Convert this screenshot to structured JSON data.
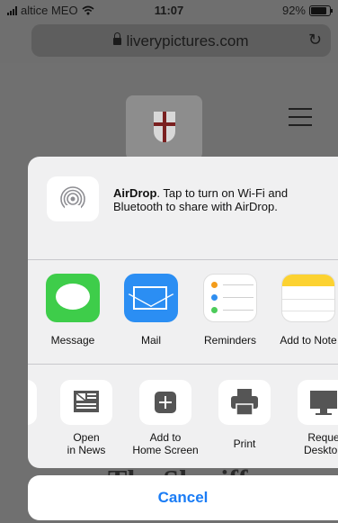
{
  "status_bar": {
    "carrier": "altice MEO",
    "time": "11:07",
    "battery": "92%",
    "battery_level": 0.92
  },
  "url_bar": {
    "domain": "liverypictures.com",
    "reload_icon": "reload-icon"
  },
  "background_page": {
    "heading_partial": "The Sheriff"
  },
  "share_sheet": {
    "airdrop": {
      "title": "AirDrop",
      "description": ". Tap to turn on Wi-Fi and Bluetooth to share with AirDrop."
    },
    "apps": [
      {
        "label": "Message",
        "icon": "message-icon"
      },
      {
        "label": "Mail",
        "icon": "mail-icon"
      },
      {
        "label": "Reminders",
        "icon": "reminders-icon"
      },
      {
        "label": "Add to Note",
        "icon": "notes-icon"
      }
    ],
    "actions": [
      {
        "label_line1": "Open",
        "label_line2": "in News",
        "icon": "news-icon"
      },
      {
        "label_line1": "Add to",
        "label_line2": "Home Screen",
        "icon": "add-icon"
      },
      {
        "label_line1": "Print",
        "label_line2": "",
        "icon": "print-icon"
      },
      {
        "label_line1": "Reque",
        "label_line2": "Desktop",
        "icon": "desktop-icon"
      }
    ],
    "cancel_label": "Cancel"
  },
  "colors": {
    "accent": "#1a7cf5",
    "message_green": "#3ecd4a",
    "mail_blue": "#2b8ef3",
    "notes_yellow": "#fcd231"
  }
}
